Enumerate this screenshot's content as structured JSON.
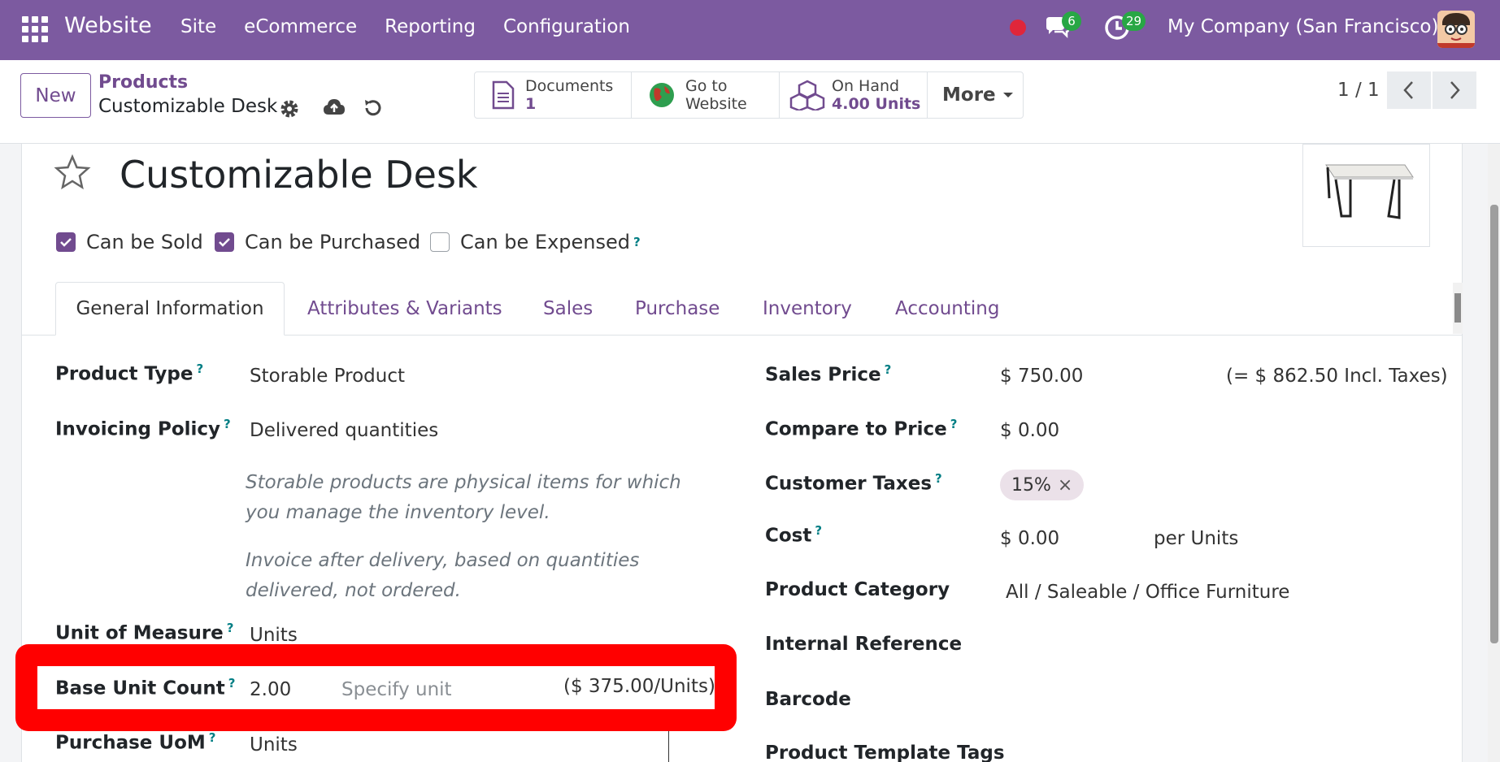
{
  "navbar": {
    "app_name": "Website",
    "menu": [
      "Site",
      "eCommerce",
      "Reporting",
      "Configuration"
    ],
    "messages_count": "6",
    "activities_count": "29",
    "company": "My Company (San Francisco)",
    "brand_color": "#7c5aa0"
  },
  "control": {
    "new_label": "New",
    "breadcrumb_parent": "Products",
    "breadcrumb_current": "Customizable Desk",
    "stats": {
      "documents_label": "Documents",
      "documents_value": "1",
      "website_label_1": "Go to",
      "website_label_2": "Website",
      "onhand_label": "On Hand",
      "onhand_value": "4.00 Units",
      "more_label": "More"
    },
    "pager": "1 / 1"
  },
  "form": {
    "title": "Customizable Desk",
    "checks": {
      "can_be_sold": "Can be Sold",
      "can_be_purchased": "Can be Purchased",
      "can_be_expensed": "Can be Expensed"
    },
    "tabs": [
      "General Information",
      "Attributes & Variants",
      "Sales",
      "Purchase",
      "Inventory",
      "Accounting"
    ],
    "left": {
      "product_type_label": "Product Type",
      "product_type_value": "Storable Product",
      "invoicing_policy_label": "Invoicing Policy",
      "invoicing_policy_value": "Delivered quantities",
      "note_1": "Storable products are physical items for which you manage the inventory level.",
      "note_2": "Invoice after delivery, based on quantities delivered, not ordered.",
      "uom_label": "Unit of Measure",
      "uom_value": "Units",
      "base_unit_count_label": "Base Unit Count",
      "base_unit_count_value": "2.00",
      "base_unit_placeholder": "Specify unit",
      "base_unit_price": "($ 375.00/Units)",
      "purchase_uom_label": "Purchase UoM",
      "purchase_uom_value": "Units"
    },
    "right": {
      "sales_price_label": "Sales Price",
      "sales_price_value": "$ 750.00",
      "sales_price_incl": "(= $ 862.50 Incl. Taxes)",
      "compare_price_label": "Compare to Price",
      "compare_price_value": "$ 0.00",
      "customer_taxes_label": "Customer Taxes",
      "customer_taxes_tag": "15%",
      "cost_label": "Cost",
      "cost_value": "$ 0.00",
      "cost_per": "per Units",
      "category_label": "Product Category",
      "category_value": "All / Saleable / Office Furniture",
      "internal_ref_label": "Internal Reference",
      "barcode_label": "Barcode",
      "template_tags_label": "Product Template Tags"
    }
  }
}
